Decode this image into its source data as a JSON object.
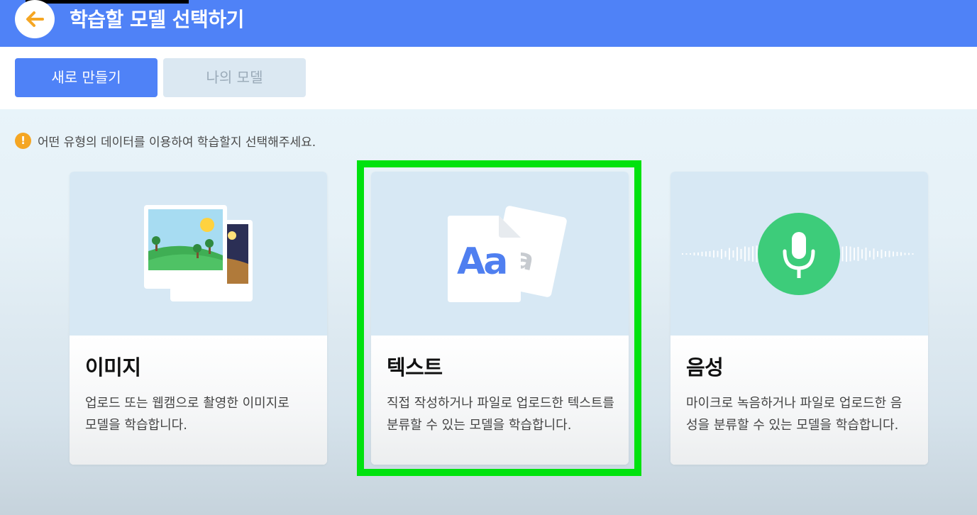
{
  "header": {
    "title": "학습할 모델 선택하기",
    "back_icon": "arrow-left-icon"
  },
  "tabs": [
    {
      "label": "새로 만들기",
      "active": true
    },
    {
      "label": "나의 모델",
      "active": false
    }
  ],
  "notice": {
    "icon": "exclamation-icon",
    "text": "어떤 유형의 데이터를 이용하여 학습할지 선택해주세요."
  },
  "cards": [
    {
      "title": "이미지",
      "description": "업로드 또는 웹캠으로 촬영한 이미지로 모델을 학습합니다.",
      "icon": "image-photo-icon"
    },
    {
      "title": "텍스트",
      "description": "직접 작성하거나 파일로 업로드한 텍스트를 분류할 수 있는 모델을 학습합니다.",
      "icon": "text-document-icon",
      "selected": true
    },
    {
      "title": "음성",
      "description": "마이크로 녹음하거나 파일로 업로드한 음성을 분류할 수 있는 모델을 학습합니다.",
      "icon": "microphone-icon"
    }
  ],
  "colors": {
    "primary": "#4f82f7",
    "highlight": "#00e20f",
    "warning": "#f5a623",
    "mic_green": "#3dcc7a"
  },
  "text_icon_glyph": "Aa",
  "text_icon_back_glyph": "a"
}
